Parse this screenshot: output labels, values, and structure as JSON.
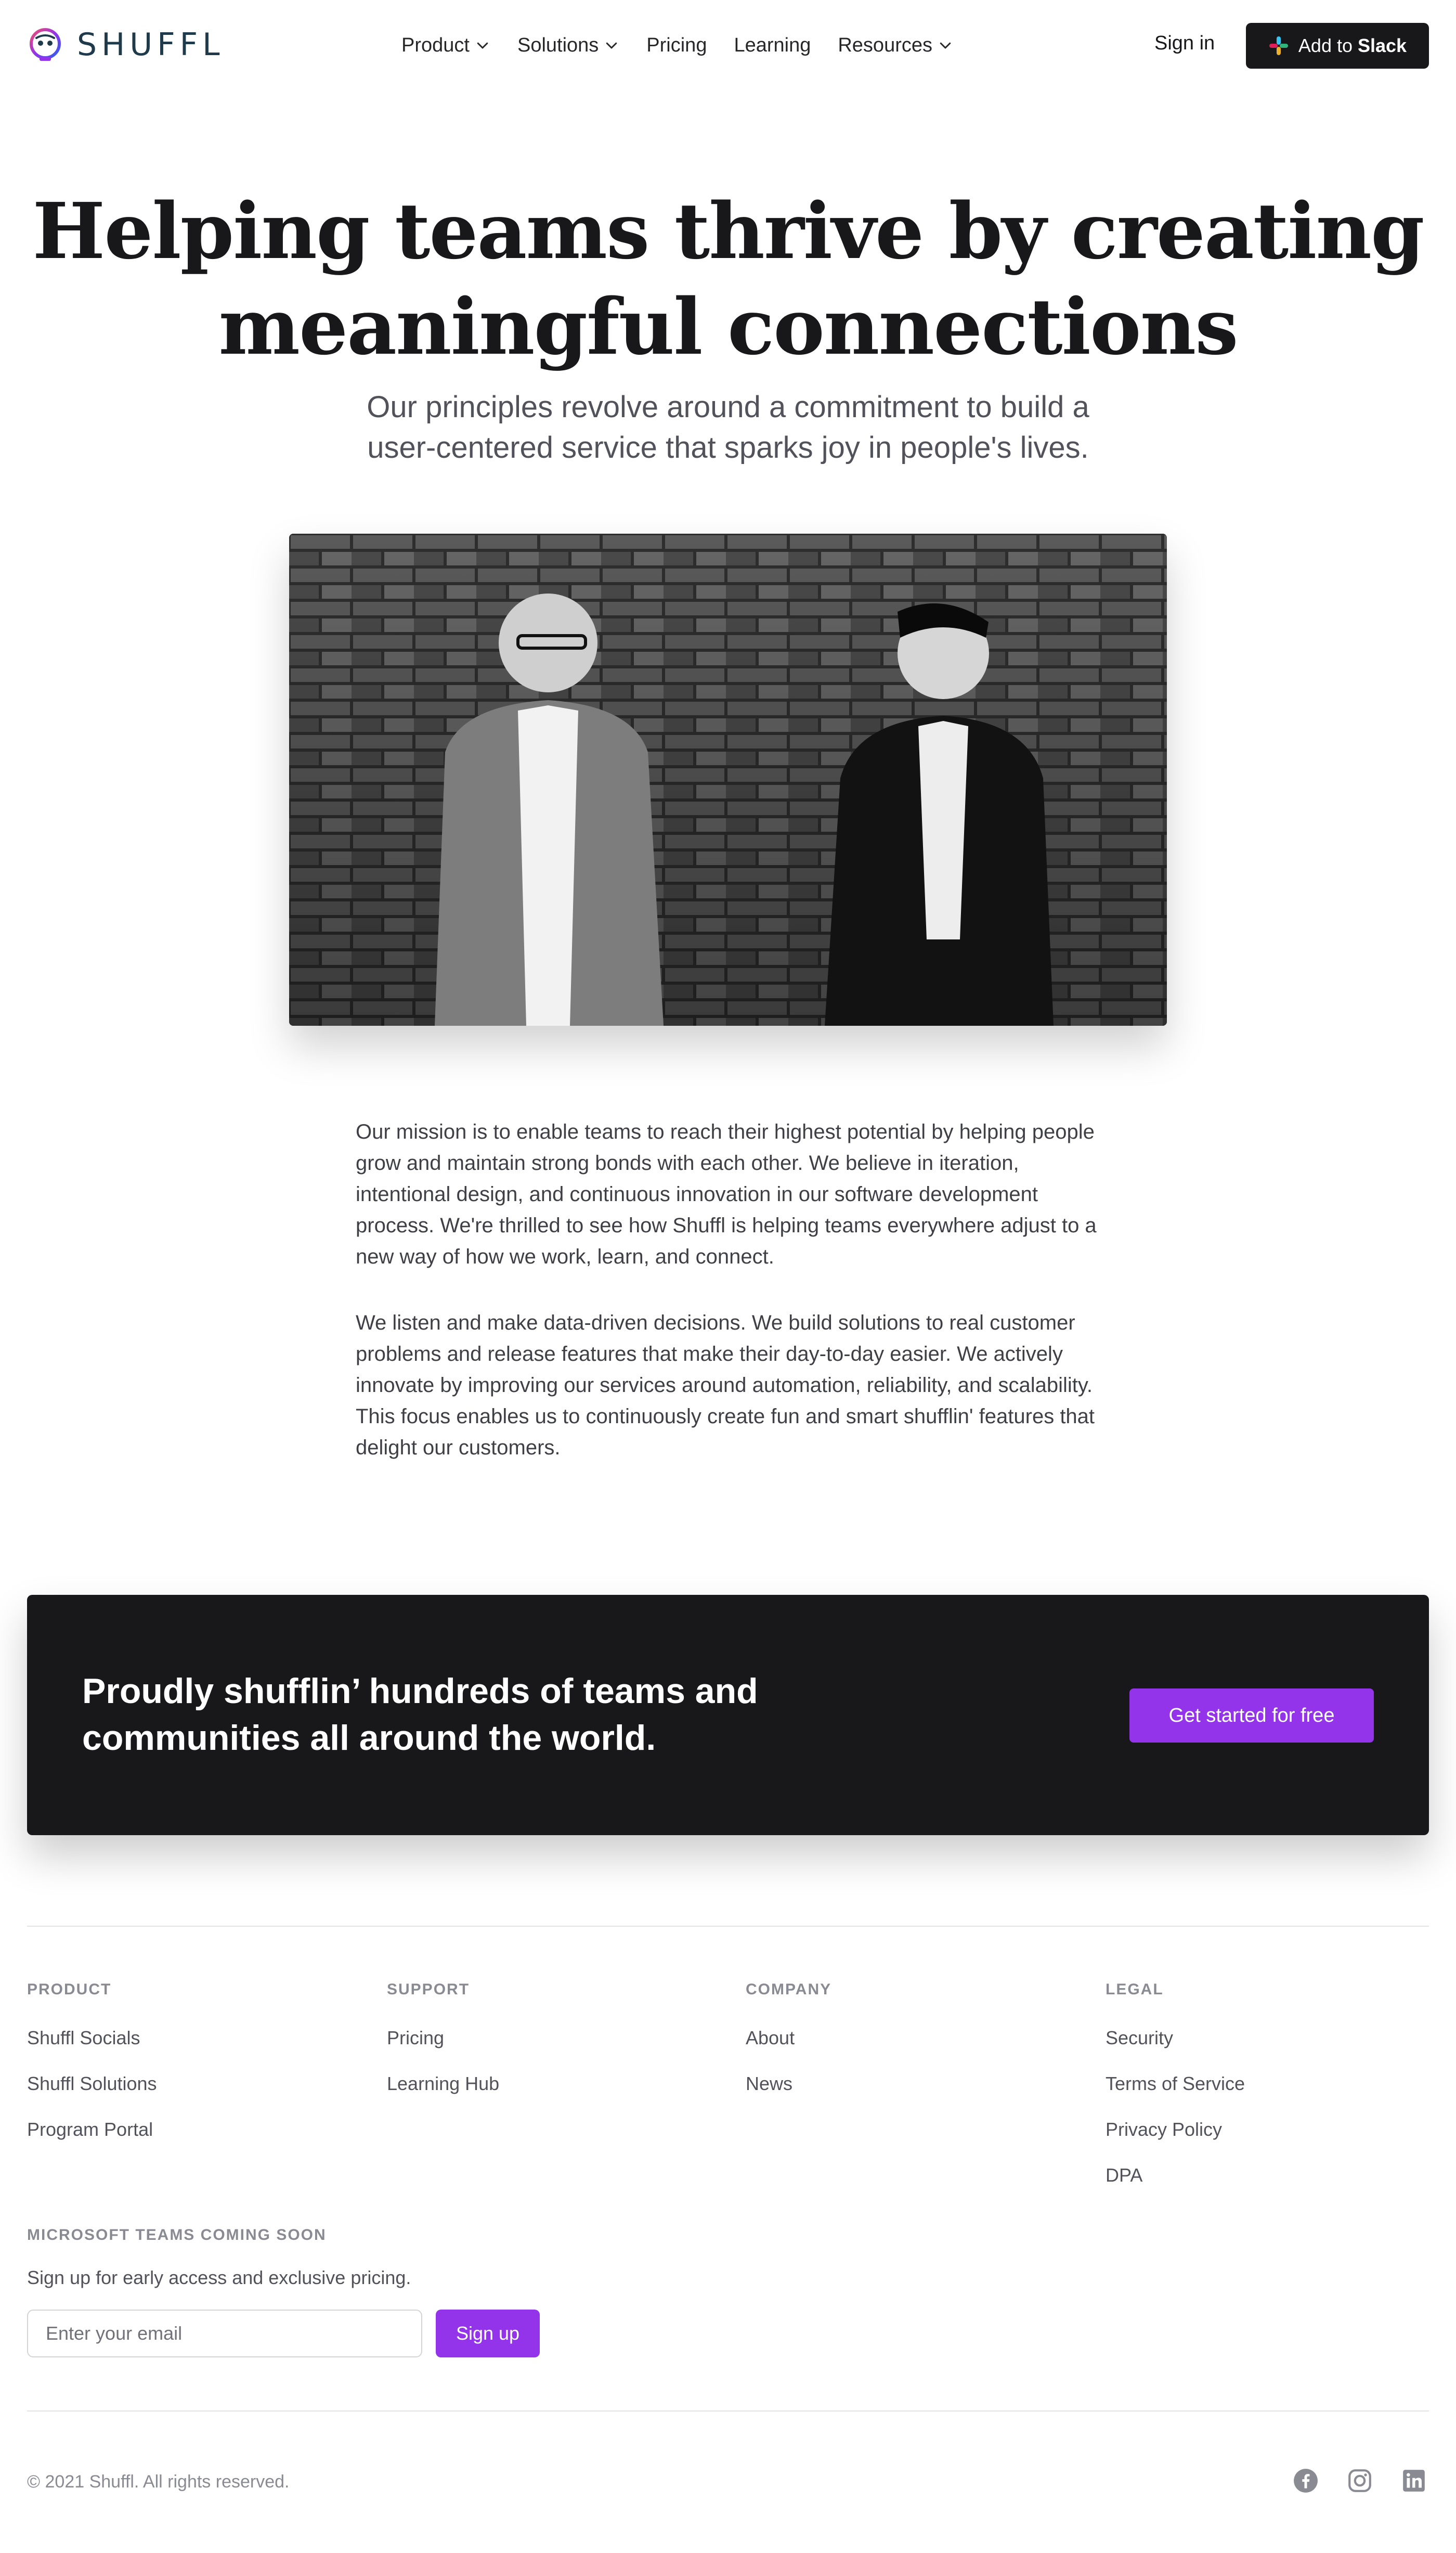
{
  "header": {
    "logo_text": "SHUFFL",
    "nav": [
      {
        "label": "Product",
        "has_dropdown": true
      },
      {
        "label": "Solutions",
        "has_dropdown": true
      },
      {
        "label": "Pricing",
        "has_dropdown": false
      },
      {
        "label": "Learning",
        "has_dropdown": false
      },
      {
        "label": "Resources",
        "has_dropdown": true
      }
    ],
    "sign_in": "Sign in",
    "slack_button": {
      "prefix": "Add to",
      "brand": "Slack"
    }
  },
  "hero": {
    "title_line1": "Helping teams thrive by creating",
    "title_line2": "meaningful connections",
    "subtitle": "Our principles revolve around a commitment to build a user-centered service that sparks joy in people's lives."
  },
  "photo": {
    "icon": "team-photo"
  },
  "body": {
    "paragraph1": "Our mission is to enable teams to reach their highest potential by helping people grow and maintain strong bonds with each other. We believe in iteration, intentional design, and continuous innovation in our software development process. We're thrilled to see how Shuffl is helping teams everywhere adjust to a new way of how we work, learn, and connect.",
    "paragraph2": "We listen and make data-driven decisions. We build solutions to real customer problems and release features that make their day-to-day easier. We actively innovate by improving our services around automation, reliability, and scalability. This focus enables us to continuously create fun and smart shufflin' features that delight our customers."
  },
  "cta": {
    "title": "Proudly shufflin’ hundreds of teams and communities all around the world.",
    "button": "Get started for free"
  },
  "footer": {
    "columns": [
      {
        "heading": "Product",
        "links": [
          "Shuffl Socials",
          "Shuffl Solutions",
          "Program Portal"
        ]
      },
      {
        "heading": "Support",
        "links": [
          "Pricing",
          "Learning Hub"
        ]
      },
      {
        "heading": "Company",
        "links": [
          "About",
          "News"
        ]
      },
      {
        "heading": "Legal",
        "links": [
          "Security",
          "Terms of Service",
          "Privacy Policy",
          "DPA"
        ]
      }
    ],
    "newsletter": {
      "heading": "MICROSOFT TEAMS COMING SOON",
      "subtitle": "Sign up for early access and exclusive pricing.",
      "placeholder": "Enter your email",
      "button": "Sign up"
    },
    "copyright": "© 2021 Shuffl. All rights reserved.",
    "social": [
      "facebook-icon",
      "instagram-icon",
      "linkedin-icon"
    ]
  },
  "colors": {
    "accent": "#9333ea",
    "dark": "#18181b",
    "muted": "#8a8a93"
  }
}
